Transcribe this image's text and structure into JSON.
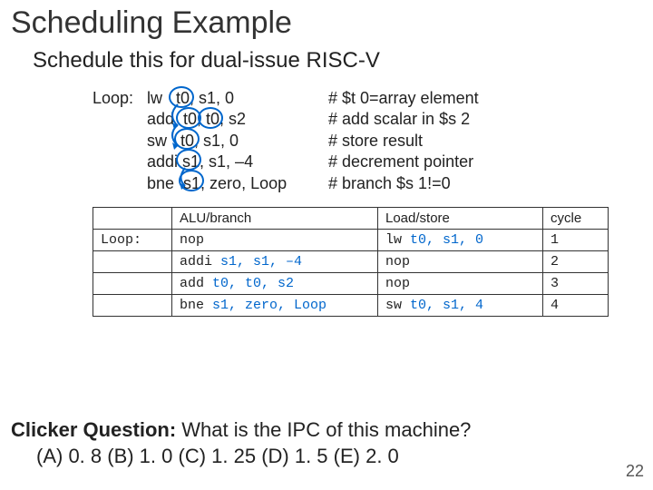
{
  "title": "Scheduling Example",
  "subtitle": "Schedule this for dual-issue RISC-V",
  "loop_label": "Loop:",
  "code": [
    {
      "instr": "lw   t0, s1, 0",
      "comment": "# $t 0=array element"
    },
    {
      "instr": "add  t0, t0, s2",
      "comment": "# add scalar in $s 2"
    },
    {
      "instr": "sw   t0, s1, 0",
      "comment": "# store result"
    },
    {
      "instr": "addi s1, s1, –4",
      "comment": "# decrement pointer"
    },
    {
      "instr": "bne  s1, zero, Loop",
      "comment": "# branch $s 1!=0"
    }
  ],
  "headers": {
    "alu": "ALU/branch",
    "ls": "Load/store",
    "cycle": "cycle"
  },
  "table": [
    {
      "label": "Loop:",
      "alu_a": "nop",
      "alu_b": "",
      "ls_a": "lw",
      "ls_b": " t0, s1, 0",
      "cycle": "1"
    },
    {
      "label": "",
      "alu_a": "addi",
      "alu_b": " s1, s1, –4",
      "ls_a": "nop",
      "ls_b": "",
      "cycle": "2"
    },
    {
      "label": "",
      "alu_a": "add",
      "alu_b": " t0, t0, s2",
      "ls_a": "nop",
      "ls_b": "",
      "cycle": "3"
    },
    {
      "label": "",
      "alu_a": "bne",
      "alu_b": " s1, zero, Loop",
      "ls_a": "sw",
      "ls_b": " t0, s1, 4",
      "cycle": "4"
    }
  ],
  "clicker": {
    "label": "Clicker Question:",
    "question": " What is the IPC of this machine?",
    "options": "(A) 0. 8    (B) 1. 0   (C)   1. 25    (D) 1. 5    (E) 2. 0"
  },
  "pagenum": "22"
}
